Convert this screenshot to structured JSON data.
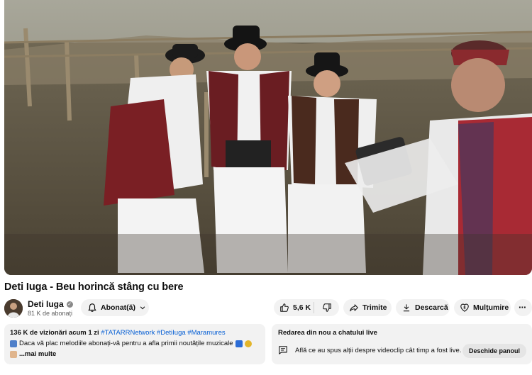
{
  "video": {
    "description": "music video frame"
  },
  "title": "Deti Iuga - Beu horincă stâng cu bere",
  "channel": {
    "name": "Deti Iuga",
    "subscribers": "81 K de abonați",
    "verified_icon": "check-icon"
  },
  "actions": {
    "subscribe_label": "Abonat(ă)",
    "likes": "5,6 K",
    "share_label": "Trimite",
    "download_label": "Descarcă",
    "thanks_label": "Mulțumire",
    "more_label": "⋯"
  },
  "description": {
    "views": "136 K de vizionări",
    "age": "acum 1 zi",
    "hashtags": "#TATARRNetwork #DetiIuga #Maramures",
    "line1": "Daca vă plac melodiile abonați-vă pentru a afla primii noutățile muzicale",
    "line2": "...mai multe"
  },
  "chat_replay": {
    "title": "Redarea din nou a chatului live",
    "text": "Află ce au spus alții despre videoclip cât timp a fost live.",
    "button": "Deschide panoul"
  },
  "colors": {
    "link_blue": "#065fd4",
    "pill_bg": "#f2f2f2",
    "text": "#0f0f0f",
    "muted": "#606060"
  }
}
